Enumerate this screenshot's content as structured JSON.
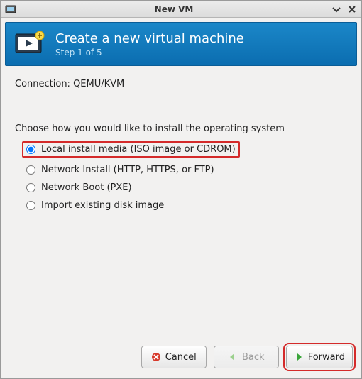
{
  "window": {
    "title": "New VM"
  },
  "banner": {
    "heading": "Create a new virtual machine",
    "step": "Step 1 of 5"
  },
  "connection": {
    "label": "Connection:",
    "value": "QEMU/KVM"
  },
  "choose_label": "Choose how you would like to install the operating system",
  "options": [
    {
      "id": "local",
      "label": "Local install media (ISO image or CDROM)",
      "selected": true,
      "highlight": true
    },
    {
      "id": "network",
      "label": "Network Install (HTTP, HTTPS, or FTP)",
      "selected": false,
      "highlight": false
    },
    {
      "id": "pxe",
      "label": "Network Boot (PXE)",
      "selected": false,
      "highlight": false
    },
    {
      "id": "import",
      "label": "Import existing disk image",
      "selected": false,
      "highlight": false
    }
  ],
  "buttons": {
    "cancel": "Cancel",
    "back": "Back",
    "forward": "Forward"
  },
  "colors": {
    "banner_top": "#1b87c8",
    "banner_bottom": "#0b6db0",
    "highlight_border": "#d42a2a"
  }
}
